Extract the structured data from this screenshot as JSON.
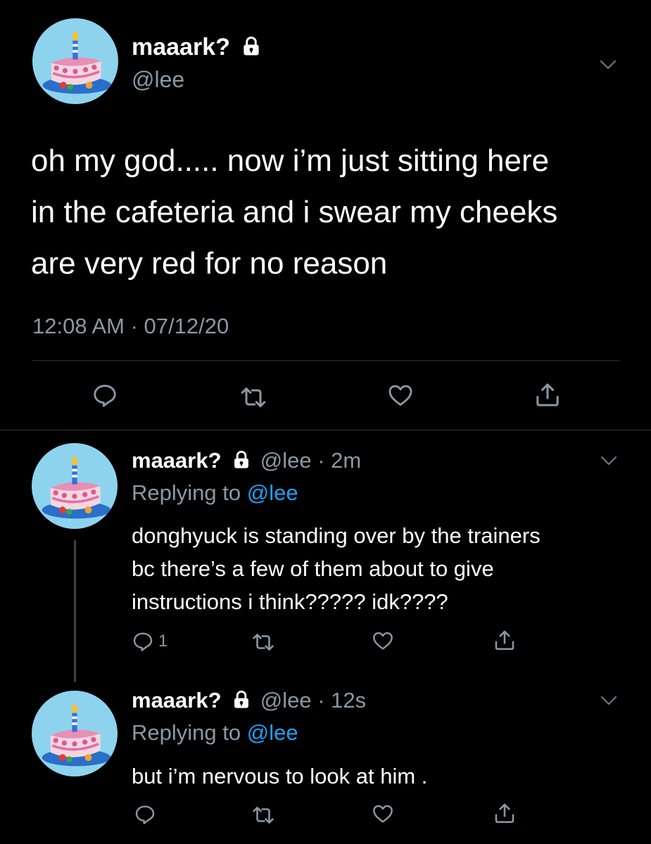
{
  "main_tweet": {
    "display_name": "maaark?",
    "handle": "@lee",
    "text_lines": [
      "oh my god..... now i’m just sitting here",
      "in the cafeteria and i swear my cheeks",
      "are very red for no reason"
    ],
    "timestamp": "12:08 AM · 07/12/20"
  },
  "replies": [
    {
      "display_name": "maaark?",
      "handle": "@lee",
      "time": "· 2m",
      "replying_prefix": "Replying to ",
      "replying_handle": "@lee",
      "text_lines": [
        "donghyuck is standing over by the trainers",
        "bc there’s a few of them about to give",
        "instructions i think????? idk????"
      ],
      "reply_count": "1"
    },
    {
      "display_name": "maaark?",
      "handle": "@lee",
      "time": "· 12s",
      "replying_prefix": "Replying to ",
      "replying_handle": "@lee",
      "text_lines": [
        "but i’m nervous to look at him ."
      ]
    }
  ],
  "icons": [
    "lock-icon",
    "chevron-down-icon",
    "reply-icon",
    "retweet-icon",
    "like-icon",
    "share-icon"
  ],
  "colors": {
    "background": "#000000",
    "accent": "#1da1f2",
    "muted": "#8b98a5",
    "avatar_bg": "#8ed3ee"
  }
}
